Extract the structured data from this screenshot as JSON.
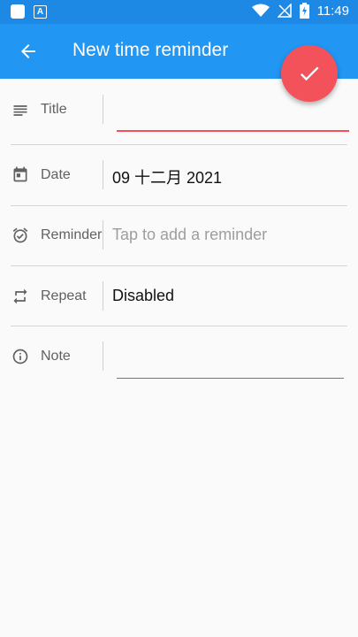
{
  "status_bar": {
    "time": "11:49",
    "icons": [
      "app-square-icon",
      "a-notification-icon",
      "wifi-icon",
      "no-signal-icon",
      "battery-charging-icon"
    ]
  },
  "app_bar": {
    "title": "New time reminder",
    "back_icon": "arrow-back-icon",
    "background": "#2196f3"
  },
  "fab": {
    "icon": "check-icon",
    "color": "#f4525a"
  },
  "form": {
    "title": {
      "label": "Title",
      "icon": "subject-lines-icon",
      "value": ""
    },
    "date": {
      "label": "Date",
      "icon": "calendar-icon",
      "value": "09 十二月 2021"
    },
    "reminder": {
      "label": "Reminder",
      "icon": "alarm-icon",
      "placeholder": "Tap to add a reminder"
    },
    "repeat": {
      "label": "Repeat",
      "icon": "repeat-icon",
      "value": "Disabled"
    },
    "note": {
      "label": "Note",
      "icon": "info-icon",
      "value": ""
    }
  }
}
